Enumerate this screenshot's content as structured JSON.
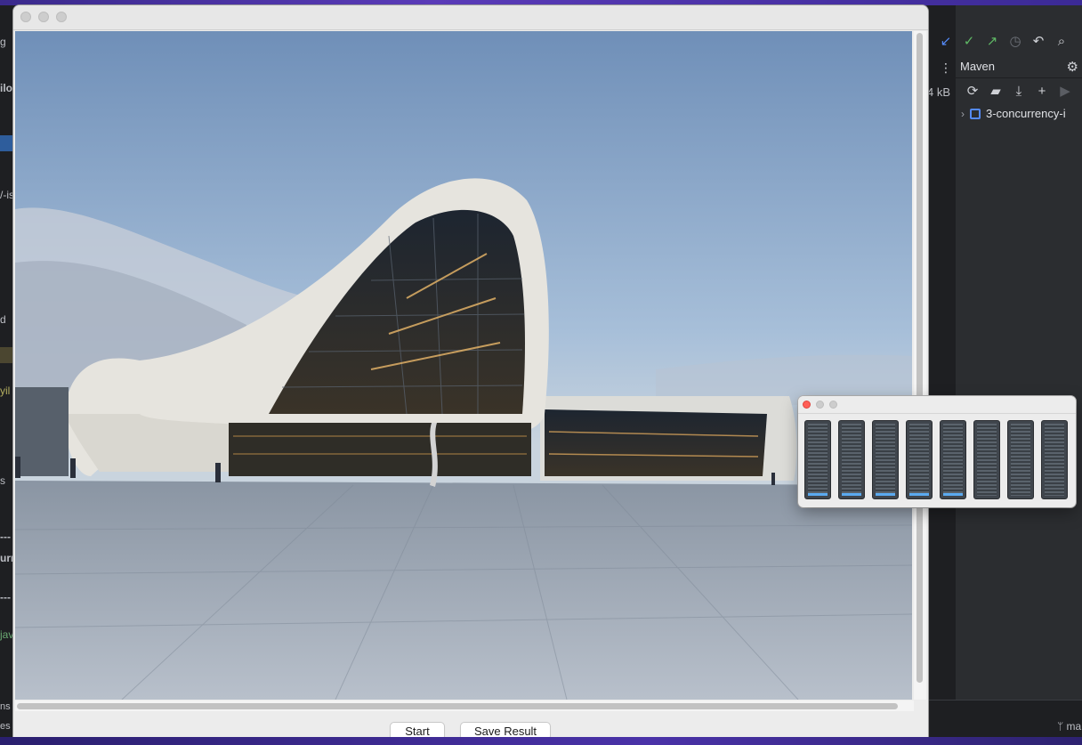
{
  "ide_left": {
    "fragments": [
      "g",
      "ilo",
      "/-is",
      "d",
      "yil",
      "s",
      "---",
      "urr",
      "---",
      "jav",
      "ns",
      "es a"
    ]
  },
  "ide_right": {
    "maven_title": "Maven",
    "size_label": "4 kB",
    "tree_item": "3-concurrency-i",
    "branch": "ma",
    "toolbar_icons": [
      "update-arrow-icon",
      "commit-check-icon",
      "push-arrow-icon",
      "history-clock-icon",
      "rollback-icon",
      "search-icon"
    ],
    "maven_tools": [
      "reload-icon",
      "add-folder-icon",
      "download-icon",
      "plus-icon",
      "run-icon"
    ]
  },
  "image_window": {
    "start_label": "Start",
    "save_label": "Save Result"
  },
  "monitor": {
    "bar_levels": [
      0.07,
      0.07,
      0.07,
      0.07,
      0.07,
      0,
      0,
      0
    ],
    "fill_color": "#5aaaf0"
  }
}
